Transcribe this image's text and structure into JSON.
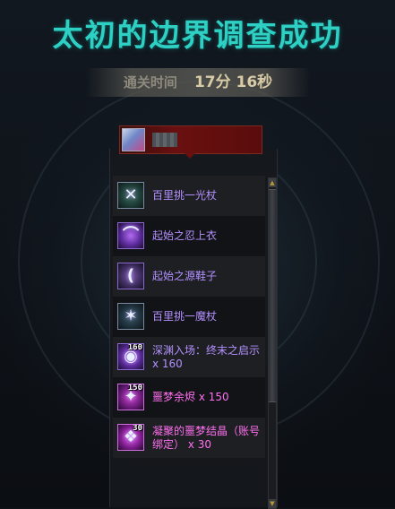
{
  "title": "太初的边界调查成功",
  "clear_time": {
    "label": "通关时间",
    "value": "17分 16秒"
  },
  "player": {
    "avatar_icon": "player-avatar-icon"
  },
  "rewards": [
    {
      "name": "百里挑一光杖",
      "icon": "staff-icon",
      "count": "",
      "color": "#b490ff"
    },
    {
      "name": "起始之忍上衣",
      "icon": "coat-icon",
      "count": "",
      "color": "#b490ff"
    },
    {
      "name": "起始之源鞋子",
      "icon": "shoes-icon",
      "count": "",
      "color": "#b490ff"
    },
    {
      "name": "百里挑一魔杖",
      "icon": "wand-icon",
      "count": "",
      "color": "#b490ff"
    },
    {
      "name": "深渊入场：终末之启示 x 160",
      "icon": "abyss-ticket-icon",
      "count": "160",
      "color": "#b490ff"
    },
    {
      "name": "噩梦余烬 x 150",
      "icon": "ember-icon",
      "count": "150",
      "color": "#ff6ff0"
    },
    {
      "name": "凝聚的噩梦结晶（账号绑定） x 30",
      "icon": "crystal-icon",
      "count": "30",
      "color": "#ff6ff0"
    }
  ],
  "scrollbar": {
    "up_icon": "scroll-up-arrow-icon",
    "down_icon": "scroll-down-arrow-icon"
  }
}
